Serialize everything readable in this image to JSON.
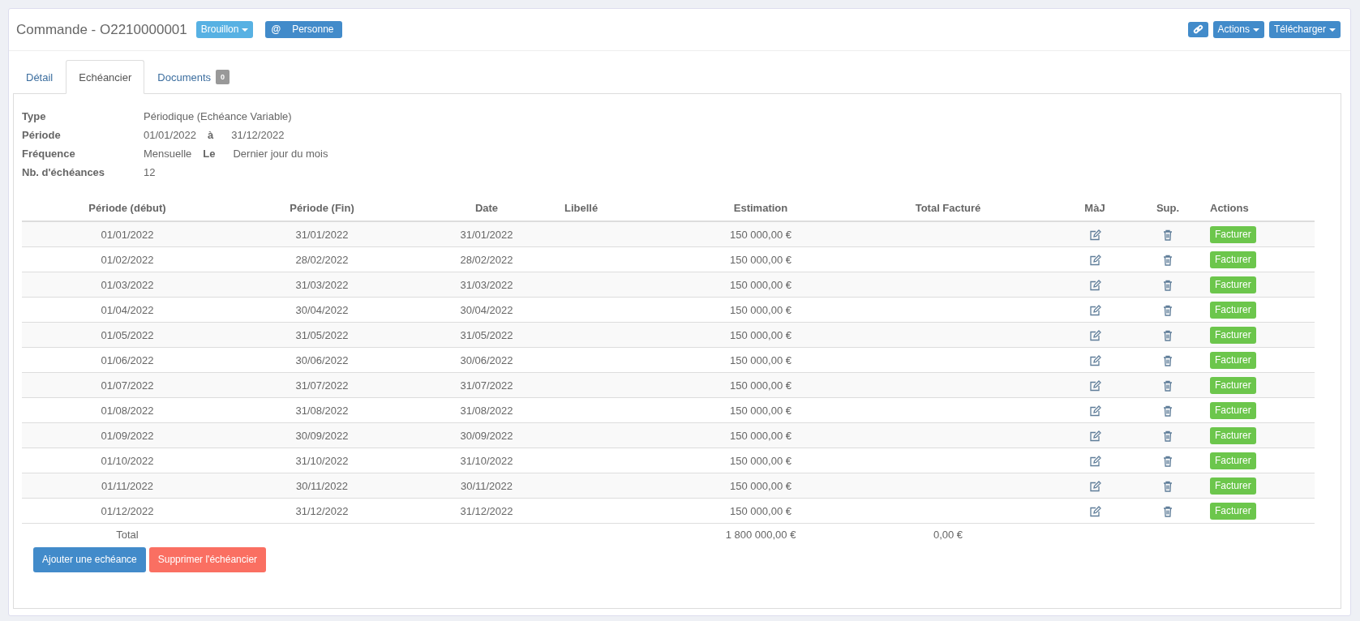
{
  "header": {
    "title": "Commande - O2210000001",
    "status": "Brouillon",
    "contact_icon": "@",
    "contact": "Personne",
    "buttons": [
      {
        "kind": "link"
      },
      {
        "kind": "dropdown",
        "label": "Actions"
      },
      {
        "kind": "dropdown",
        "label": "Télécharger"
      }
    ]
  },
  "tabs": [
    {
      "label": "Détail",
      "selected": false
    },
    {
      "label": "Echéancier",
      "selected": true
    },
    {
      "label": "Documents",
      "badge": "0",
      "selected": false
    }
  ],
  "info": [
    {
      "label": "Type",
      "parts": [
        {
          "kind": "value",
          "text": "Périodique (Echéance Variable)"
        }
      ]
    },
    {
      "label": "Période",
      "parts": [
        {
          "kind": "value",
          "text": "01/01/2022"
        },
        {
          "kind": "keyword",
          "text": "à"
        },
        {
          "kind": "value",
          "text": "31/12/2022"
        }
      ]
    },
    {
      "label": "Fréquence",
      "parts": [
        {
          "kind": "value",
          "text": "Mensuelle"
        },
        {
          "kind": "keyword",
          "text": "Le"
        },
        {
          "kind": "value",
          "text": "Dernier jour du mois"
        }
      ]
    },
    {
      "label": "Nb. d'échéances",
      "parts": [
        {
          "kind": "value",
          "text": "12"
        }
      ]
    }
  ],
  "table": {
    "columns": [
      "Période (début)",
      "Période (Fin)",
      "Date",
      "Libellé",
      "Estimation",
      "Total Facturé",
      "MàJ",
      "Sup.",
      "Actions"
    ],
    "rows": [
      {
        "start": "01/01/2022",
        "end": "31/01/2022",
        "date": "31/01/2022",
        "estimation": "150 000,00 €",
        "action": "Facturer"
      },
      {
        "start": "01/02/2022",
        "end": "28/02/2022",
        "date": "28/02/2022",
        "estimation": "150 000,00 €",
        "action": "Facturer"
      },
      {
        "start": "01/03/2022",
        "end": "31/03/2022",
        "date": "31/03/2022",
        "estimation": "150 000,00 €",
        "action": "Facturer"
      },
      {
        "start": "01/04/2022",
        "end": "30/04/2022",
        "date": "30/04/2022",
        "estimation": "150 000,00 €",
        "action": "Facturer"
      },
      {
        "start": "01/05/2022",
        "end": "31/05/2022",
        "date": "31/05/2022",
        "estimation": "150 000,00 €",
        "action": "Facturer"
      },
      {
        "start": "01/06/2022",
        "end": "30/06/2022",
        "date": "30/06/2022",
        "estimation": "150 000,00 €",
        "action": "Facturer"
      },
      {
        "start": "01/07/2022",
        "end": "31/07/2022",
        "date": "31/07/2022",
        "estimation": "150 000,00 €",
        "action": "Facturer"
      },
      {
        "start": "01/08/2022",
        "end": "31/08/2022",
        "date": "31/08/2022",
        "estimation": "150 000,00 €",
        "action": "Facturer"
      },
      {
        "start": "01/09/2022",
        "end": "30/09/2022",
        "date": "30/09/2022",
        "estimation": "150 000,00 €",
        "action": "Facturer"
      },
      {
        "start": "01/10/2022",
        "end": "31/10/2022",
        "date": "31/10/2022",
        "estimation": "150 000,00 €",
        "action": "Facturer"
      },
      {
        "start": "01/11/2022",
        "end": "30/11/2022",
        "date": "30/11/2022",
        "estimation": "150 000,00 €",
        "action": "Facturer"
      },
      {
        "start": "01/12/2022",
        "end": "31/12/2022",
        "date": "31/12/2022",
        "estimation": "150 000,00 €",
        "action": "Facturer"
      }
    ],
    "total": {
      "label": "Total",
      "estimation": "1 800 000,00 €",
      "invoiced": "0,00 €"
    }
  },
  "buttons": [
    {
      "kind": "primary",
      "label": "Ajouter une echéance"
    },
    {
      "kind": "danger",
      "label": "Supprimer l'échéancier"
    }
  ]
}
